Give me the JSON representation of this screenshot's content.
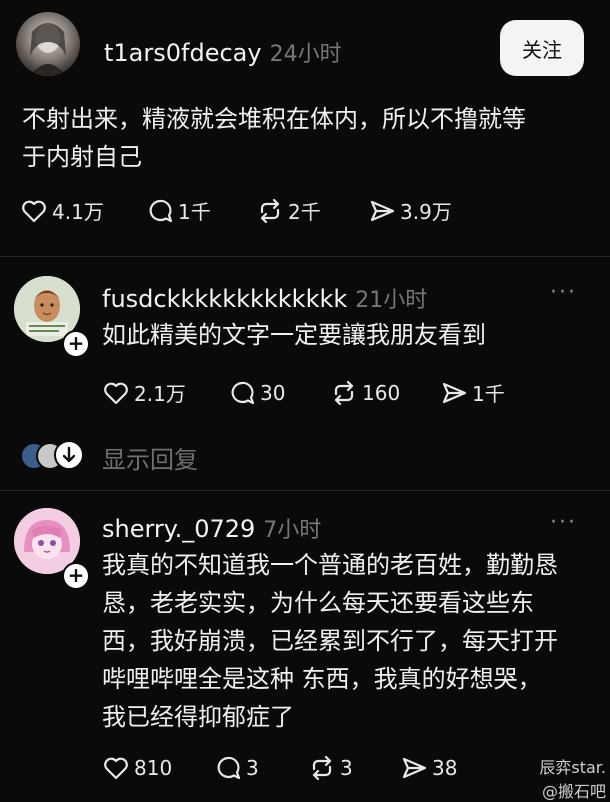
{
  "post": {
    "username": "t1ars0fdecay",
    "time": "24小时",
    "follow_label": "关注",
    "text_line1": "不射出来，精液就会堆积在体内，所以不撸就等",
    "text_line2": "于内射自己",
    "likes": "4.1万",
    "comments": "1千",
    "reposts": "2千",
    "shares": "3.9万"
  },
  "reply1": {
    "username": "fusdckkkkkkkkkkkkk",
    "time": "21小时",
    "more": "···",
    "text": "如此精美的文字一定要讓我朋友看到",
    "likes": "2.1万",
    "comments": "30",
    "reposts": "160",
    "shares": "1千",
    "show_replies": "显示回复"
  },
  "reply2": {
    "username": "sherry._0729",
    "time": "7小时",
    "more": "···",
    "text_line1": "我真的不知道我一个普通的老百姓，勤勤恳",
    "text_line2": "恳，老老实实，为什么每天还要看这些东",
    "text_line3": "西，我好崩溃，已经累到不行了，每天打开",
    "text_line4": "哔哩哔哩全是这种 东西，我真的好想哭，",
    "text_line5": "我已经得抑郁症了",
    "likes": "810",
    "comments": "3",
    "reposts": "3",
    "shares": "38"
  },
  "watermark": {
    "line1": "辰弈star.",
    "line2": "@搬石吧"
  },
  "icons": {
    "like": "heart-icon",
    "comment": "comment-bubble-icon",
    "repost": "repost-icon",
    "share": "share-send-icon",
    "add": "plus-icon"
  }
}
